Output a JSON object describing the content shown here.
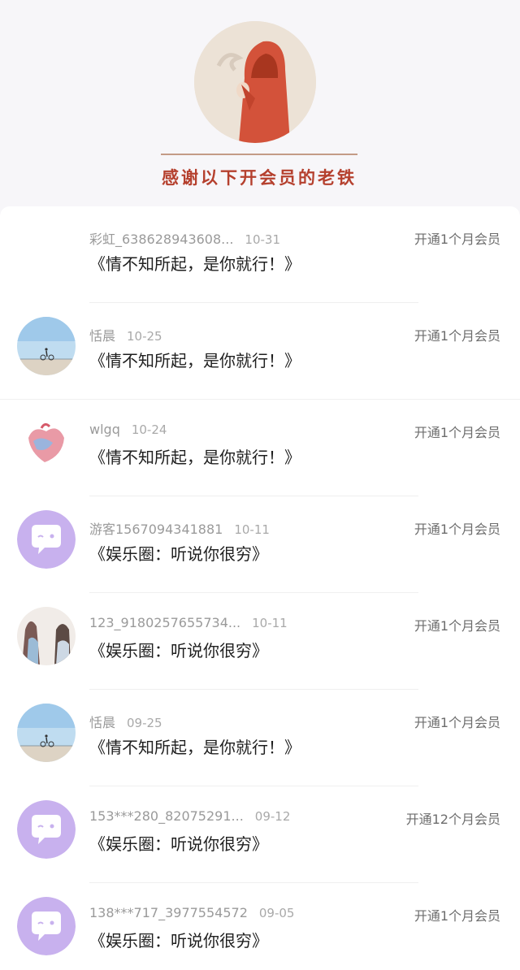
{
  "header": {
    "caption": "感谢以下开会员的老铁"
  },
  "rows": [
    {
      "name": "彩虹_638628943608...",
      "date": "10-31",
      "content": "《情不知所起，是你就行！》",
      "plan": "开通1个月会员",
      "avatar": "none"
    },
    {
      "name": "恬晨",
      "date": "10-25",
      "content": "《情不知所起，是你就行！》",
      "plan": "开通1个月会员",
      "avatar": "beach-cyclist"
    },
    {
      "name": "wlgq",
      "date": "10-24",
      "content": "《情不知所起，是你就行！》",
      "plan": "开通1个月会员",
      "avatar": "heart-art"
    },
    {
      "name": "游客1567094341881",
      "date": "10-11",
      "content": "《娱乐圈：听说你很穷》",
      "plan": "开通1个月会员",
      "avatar": "chat-bubble"
    },
    {
      "name": "123_9180257655734...",
      "date": "10-11",
      "content": "《娱乐圈：听说你很穷》",
      "plan": "开通1个月会员",
      "avatar": "two-girls"
    },
    {
      "name": "恬晨",
      "date": "09-25",
      "content": "《情不知所起，是你就行！》",
      "plan": "开通1个月会员",
      "avatar": "beach-cyclist"
    },
    {
      "name": "153***280_82075291...",
      "date": "09-12",
      "content": "《娱乐圈：听说你很穷》",
      "plan": "开通12个月会员",
      "avatar": "chat-bubble"
    },
    {
      "name": "138***717_3977554572",
      "date": "09-05",
      "content": "《娱乐圈：听说你很穷》",
      "plan": "开通1个月会员",
      "avatar": "chat-bubble"
    }
  ],
  "colors": {
    "accent_purple": "#c8b1ee",
    "caption_red": "#b5402e"
  }
}
